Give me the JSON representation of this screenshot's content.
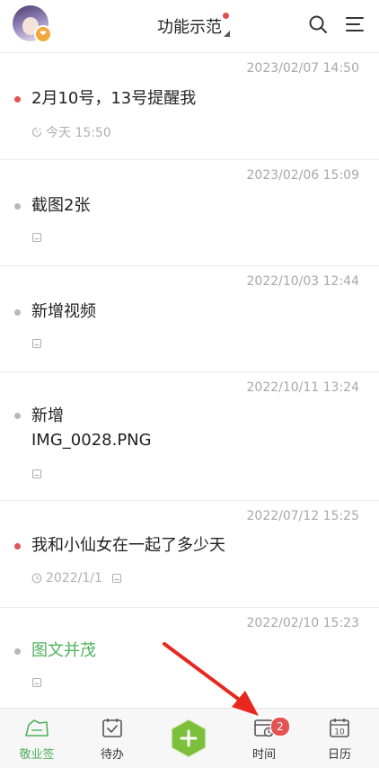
{
  "header": {
    "title": "功能示范",
    "avatar_badge": "❤"
  },
  "notes": [
    {
      "timestamp": "2023/02/07 14:50",
      "title": "2月10号，13号提醒我",
      "dot": "red",
      "meta_text": "今天 15:50",
      "meta_icon": "reminder-clock-icon",
      "has_attachment": false,
      "title_color": "default"
    },
    {
      "timestamp": "2023/02/06 15:09",
      "title": "截图2张",
      "dot": "grey",
      "meta_text": "",
      "meta_icon": "attachment-icon",
      "has_attachment": true,
      "title_color": "default"
    },
    {
      "timestamp": "2022/10/03 12:44",
      "title": "新增视频",
      "dot": "grey",
      "meta_text": "",
      "meta_icon": "attachment-icon",
      "has_attachment": true,
      "title_color": "default"
    },
    {
      "timestamp": "2022/10/11 13:24",
      "title_lines": [
        "新增",
        "IMG_0028.PNG"
      ],
      "dot": "grey",
      "meta_text": "",
      "meta_icon": "attachment-icon",
      "has_attachment": true,
      "title_color": "default"
    },
    {
      "timestamp": "2022/07/12 15:25",
      "title": "我和小仙女在一起了多少天",
      "dot": "red",
      "meta_text": "2022/1/1",
      "meta_icon": "clock-icon",
      "has_attachment": true,
      "title_color": "default"
    },
    {
      "timestamp": "2022/02/10 15:23",
      "title": "图文并茂",
      "dot": "grey",
      "meta_text": "",
      "meta_icon": "attachment-icon",
      "has_attachment": true,
      "title_color": "green"
    }
  ],
  "tabbar": {
    "tabs": [
      {
        "label": "敬业签",
        "icon": "note-home-icon",
        "active": true
      },
      {
        "label": "待办",
        "icon": "todo-check-icon",
        "active": false
      },
      {
        "label": "",
        "icon": "plus-icon",
        "active": false
      },
      {
        "label": "时间",
        "icon": "time-calendar-icon",
        "active": false,
        "badge": "2"
      },
      {
        "label": "日历",
        "icon": "calendar-icon",
        "active": false,
        "calendar_day": "10"
      }
    ]
  },
  "colors": {
    "accent_green": "#4fb25a",
    "alert_red": "#e05555",
    "arrow_red": "#e8271f"
  }
}
